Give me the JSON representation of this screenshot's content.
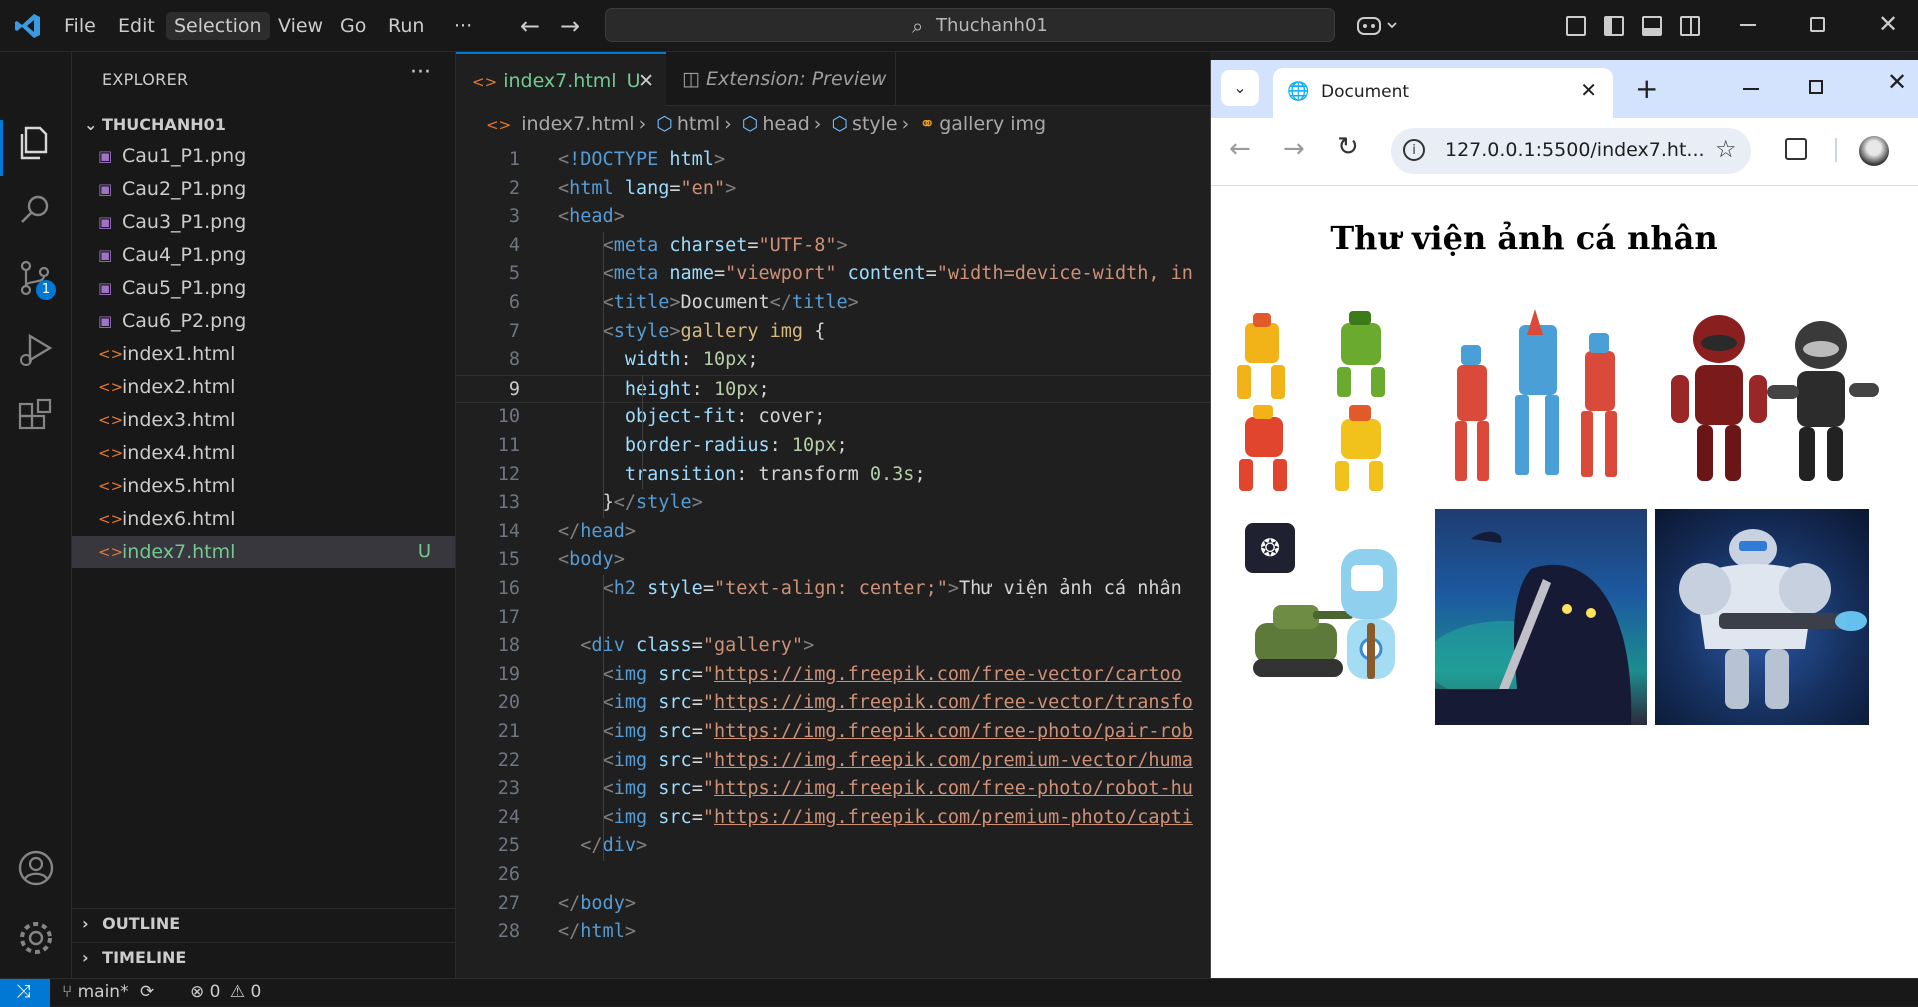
{
  "titlebar": {
    "menu": [
      "File",
      "Edit",
      "Selection",
      "View",
      "Go",
      "Run",
      "···"
    ],
    "active_menu": "Selection",
    "search_text": "Thuchanh01"
  },
  "activitybar": {
    "source_control_badge": "1"
  },
  "explorer": {
    "title": "EXPLORER",
    "folder": "THUCHANH01",
    "files": [
      {
        "name": "Cau1_P1.png",
        "type": "image"
      },
      {
        "name": "Cau2_P1.png",
        "type": "image"
      },
      {
        "name": "Cau3_P1.png",
        "type": "image"
      },
      {
        "name": "Cau4_P1.png",
        "type": "image"
      },
      {
        "name": "Cau5_P1.png",
        "type": "image"
      },
      {
        "name": "Cau6_P2.png",
        "type": "image"
      },
      {
        "name": "index1.html",
        "type": "html"
      },
      {
        "name": "index2.html",
        "type": "html"
      },
      {
        "name": "index3.html",
        "type": "html"
      },
      {
        "name": "index4.html",
        "type": "html"
      },
      {
        "name": "index5.html",
        "type": "html"
      },
      {
        "name": "index6.html",
        "type": "html"
      },
      {
        "name": "index7.html",
        "type": "html",
        "badge": "U",
        "selected": true
      }
    ],
    "outline": "OUTLINE",
    "timeline": "TIMELINE"
  },
  "editor": {
    "tabs": [
      {
        "label": "index7.html",
        "badge": "U",
        "active": true
      },
      {
        "label": "Extension: Preview",
        "active": false
      }
    ],
    "breadcrumb": [
      "index7.html",
      "html",
      "head",
      "style",
      "gallery img"
    ],
    "current_line": 9,
    "lines": [
      "<!DOCTYPE html>",
      "<html lang=\"en\">",
      "<head>",
      "    <meta charset=\"UTF-8\">",
      "    <meta name=\"viewport\" content=\"width=device-width, in",
      "    <title>Document</title>",
      "    <style>gallery img {",
      "      width: 10px;",
      "      height: 10px;",
      "      object-fit: cover;",
      "      border-radius: 10px;",
      "      transition: transform 0.3s;",
      "    }</style>",
      "</head>",
      "<body>",
      "    <h2 style=\"text-align: center;\">Thư viện ảnh cá nhân",
      "",
      "  <div class=\"gallery\">",
      "    <img src=\"https://img.freepik.com/free-vector/cartoo",
      "    <img src=\"https://img.freepik.com/free-vector/transfo",
      "    <img src=\"https://img.freepik.com/free-photo/pair-rob",
      "    <img src=\"https://img.freepik.com/premium-vector/huma",
      "    <img src=\"https://img.freepik.com/free-photo/robot-hu",
      "    <img src=\"https://img.freepik.com/premium-photo/capti",
      "  </div>",
      "",
      "</body>",
      "</html>"
    ]
  },
  "statusbar": {
    "branch": "main*",
    "errors": "0",
    "warnings": "0"
  },
  "browser": {
    "tab_title": "Document",
    "url": "127.0.0.1:5500/index7.ht...",
    "page_heading": "Thư viện ảnh cá nhân"
  }
}
